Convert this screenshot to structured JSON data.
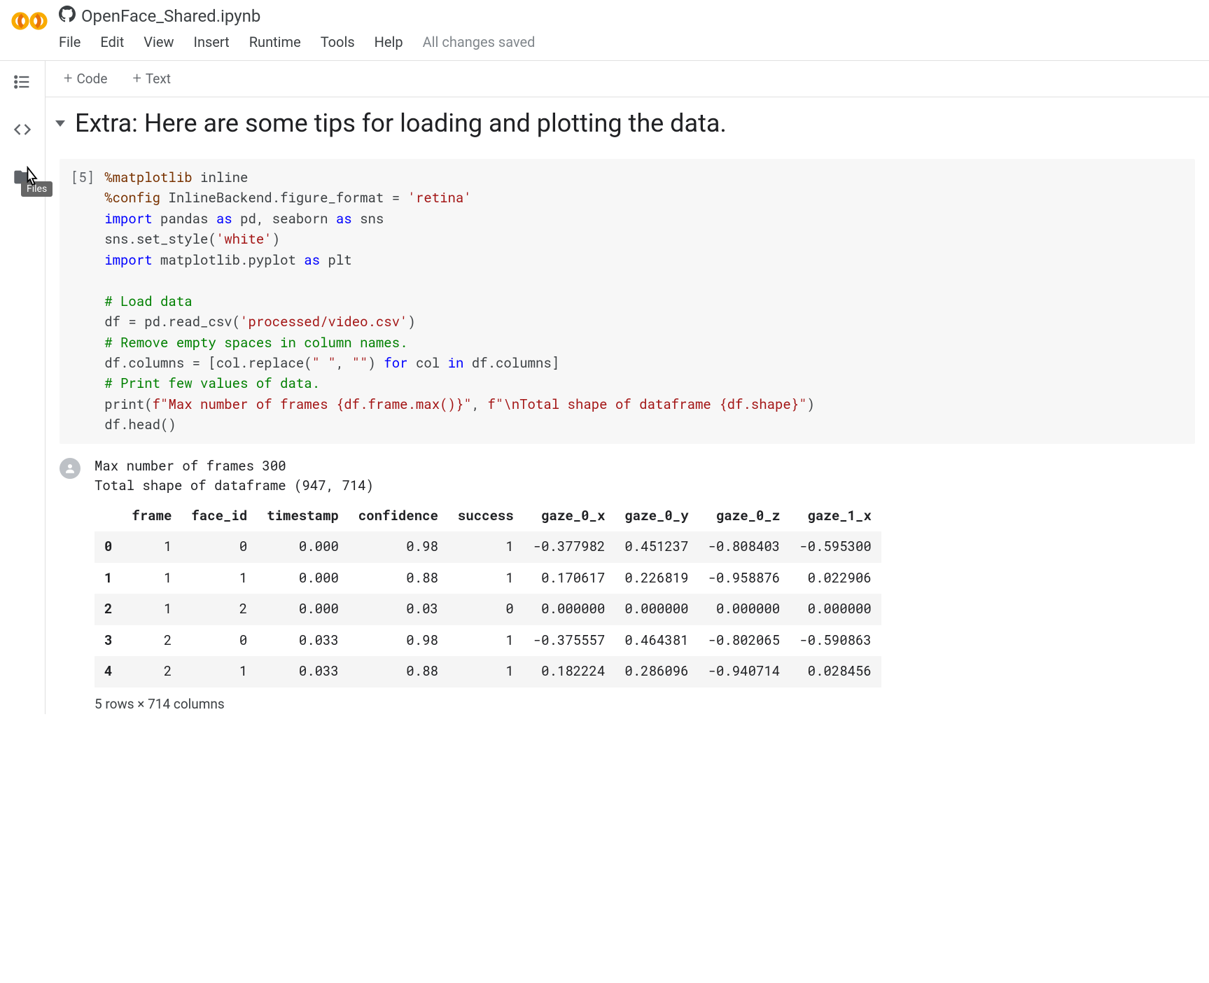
{
  "header": {
    "notebook_title": "OpenFace_Shared.ipynb",
    "save_status": "All changes saved",
    "menu": {
      "file": "File",
      "edit": "Edit",
      "view": "View",
      "insert": "Insert",
      "runtime": "Runtime",
      "tools": "Tools",
      "help": "Help"
    }
  },
  "left_rail": {
    "files_tooltip": "Files"
  },
  "toolbar": {
    "code_label": "Code",
    "text_label": "Text"
  },
  "section": {
    "heading": "Extra: Here are some tips for loading and plotting the data."
  },
  "cell": {
    "exec_count": "[5]",
    "code_lines": [
      [
        [
          "magic",
          "%matplotlib"
        ],
        [
          "plain",
          " inline"
        ]
      ],
      [
        [
          "magic",
          "%config"
        ],
        [
          "plain",
          " InlineBackend.figure_format = "
        ],
        [
          "str",
          "'retina'"
        ]
      ],
      [
        [
          "kw",
          "import"
        ],
        [
          "plain",
          " pandas "
        ],
        [
          "kw",
          "as"
        ],
        [
          "plain",
          " pd, seaborn "
        ],
        [
          "kw",
          "as"
        ],
        [
          "plain",
          " sns"
        ]
      ],
      [
        [
          "plain",
          "sns.set_style("
        ],
        [
          "str",
          "'white'"
        ],
        [
          "plain",
          ")"
        ]
      ],
      [
        [
          "kw",
          "import"
        ],
        [
          "plain",
          " matplotlib.pyplot "
        ],
        [
          "kw",
          "as"
        ],
        [
          "plain",
          " plt"
        ]
      ],
      [
        [
          "plain",
          ""
        ]
      ],
      [
        [
          "cmt",
          "# Load data"
        ]
      ],
      [
        [
          "plain",
          "df = pd.read_csv("
        ],
        [
          "str",
          "'processed/video.csv'"
        ],
        [
          "plain",
          ")"
        ]
      ],
      [
        [
          "cmt",
          "# Remove empty spaces in column names."
        ]
      ],
      [
        [
          "plain",
          "df.columns = [col.replace("
        ],
        [
          "str",
          "\" \""
        ],
        [
          "plain",
          ", "
        ],
        [
          "str",
          "\"\""
        ],
        [
          "plain",
          ") "
        ],
        [
          "kw",
          "for"
        ],
        [
          "plain",
          " col "
        ],
        [
          "kw",
          "in"
        ],
        [
          "plain",
          " df.columns]"
        ]
      ],
      [
        [
          "cmt",
          "# Print few values of data."
        ]
      ],
      [
        [
          "plain",
          "print("
        ],
        [
          "str",
          "f\"Max number of frames {df.frame.max()}\""
        ],
        [
          "plain",
          ", "
        ],
        [
          "str",
          "f\"\\nTotal shape of dataframe {df.shape}\""
        ],
        [
          "plain",
          ")"
        ]
      ],
      [
        [
          "plain",
          "df.head()"
        ]
      ]
    ]
  },
  "output": {
    "stdout": "Max number of frames 300\nTotal shape of dataframe (947, 714)",
    "table": {
      "columns": [
        "",
        "frame",
        "face_id",
        "timestamp",
        "confidence",
        "success",
        "gaze_0_x",
        "gaze_0_y",
        "gaze_0_z",
        "gaze_1_x"
      ],
      "rows": [
        [
          "0",
          "1",
          "0",
          "0.000",
          "0.98",
          "1",
          "-0.377982",
          "0.451237",
          "-0.808403",
          "-0.595300"
        ],
        [
          "1",
          "1",
          "1",
          "0.000",
          "0.88",
          "1",
          "0.170617",
          "0.226819",
          "-0.958876",
          "0.022906"
        ],
        [
          "2",
          "1",
          "2",
          "0.000",
          "0.03",
          "0",
          "0.000000",
          "0.000000",
          "0.000000",
          "0.000000"
        ],
        [
          "3",
          "2",
          "0",
          "0.033",
          "0.98",
          "1",
          "-0.375557",
          "0.464381",
          "-0.802065",
          "-0.590863"
        ],
        [
          "4",
          "2",
          "1",
          "0.033",
          "0.88",
          "1",
          "0.182224",
          "0.286096",
          "-0.940714",
          "0.028456"
        ]
      ],
      "caption": "5 rows × 714 columns"
    }
  }
}
